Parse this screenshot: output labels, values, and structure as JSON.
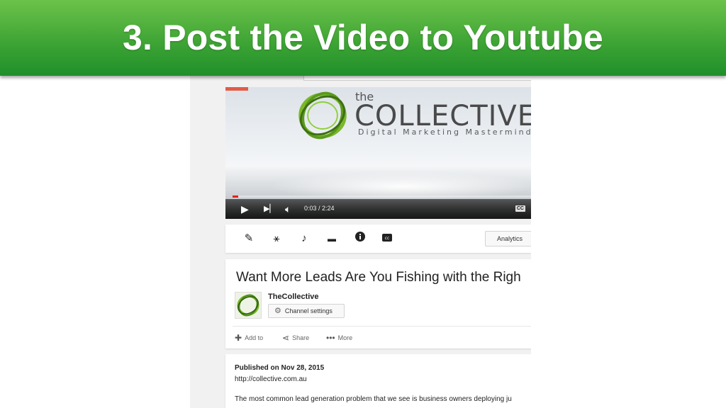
{
  "slide": {
    "title": "3. Post the Video to Youtube"
  },
  "colors": {
    "banner_top": "#6cc24a",
    "banner_bottom": "#1f8f2a",
    "youtube_red": "#e62117",
    "logo_green": "#7ab829"
  },
  "video": {
    "logo_the": "the",
    "logo_name": "COLLECTIVE",
    "logo_tagline": "Digital Marketing Mastermind",
    "time_display": "0:03 / 2:24",
    "progress_fraction": 0.02,
    "icons": {
      "play": "play-icon",
      "next": "next-icon",
      "volume": "volume-icon",
      "cc": "cc-icon"
    }
  },
  "toolbar": {
    "icons": [
      "pencil-icon",
      "magic-wand-icon",
      "music-note-icon",
      "comment-icon",
      "info-icon",
      "cc-icon"
    ],
    "analytics_label": "Analytics"
  },
  "info": {
    "video_title": "Want More Leads Are You Fishing with the Righ",
    "channel_name": "TheCollective",
    "channel_settings_label": "Channel settings",
    "actions": {
      "add_to": "Add to",
      "share": "Share",
      "more": "More"
    }
  },
  "description": {
    "published": "Published on Nov 28, 2015",
    "url": "http://collective.com.au",
    "text": "The most common lead generation problem that we see is business owners deploying ju"
  }
}
